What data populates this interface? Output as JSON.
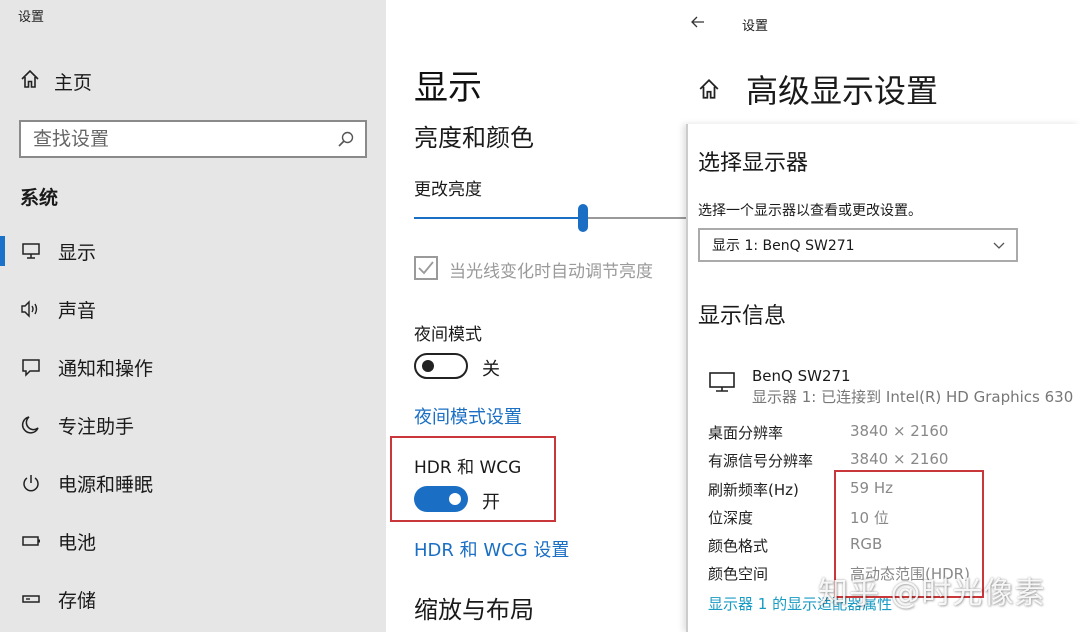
{
  "sidebar": {
    "window_title": "设置",
    "home_label": "主页",
    "search_placeholder": "查找设置",
    "section_label": "系统",
    "items": [
      {
        "label": "显示",
        "icon": "monitor-icon"
      },
      {
        "label": "声音",
        "icon": "speaker-icon"
      },
      {
        "label": "通知和操作",
        "icon": "notification-icon"
      },
      {
        "label": "专注助手",
        "icon": "moon-icon"
      },
      {
        "label": "电源和睡眠",
        "icon": "power-icon"
      },
      {
        "label": "电池",
        "icon": "battery-icon"
      },
      {
        "label": "存储",
        "icon": "storage-icon"
      }
    ]
  },
  "display": {
    "title": "显示",
    "brightness_heading": "亮度和颜色",
    "brightness_label": "更改亮度",
    "brightness_level": 0.62,
    "auto_brightness_label": "当光线变化时自动调节亮度",
    "night_mode_label": "夜间模式",
    "night_mode_state": "关",
    "night_mode_link": "夜间模式设置",
    "hdr_label": "HDR 和 WCG",
    "hdr_state": "开",
    "hdr_link": "HDR 和 WCG 设置",
    "scale_heading": "缩放与布局"
  },
  "advanced": {
    "breadcrumb": "设置",
    "title": "高级显示设置",
    "choose_heading": "选择显示器",
    "choose_sub": "选择一个显示器以查看或更改设置。",
    "selected_monitor": "显示 1: BenQ SW271",
    "info_heading": "显示信息",
    "monitor_name": "BenQ SW271",
    "monitor_desc": "显示器 1: 已连接到 Intel(R) HD Graphics 630",
    "rows": [
      {
        "key": "桌面分辨率",
        "value": "3840 × 2160"
      },
      {
        "key": "有源信号分辨率",
        "value": "3840 × 2160"
      },
      {
        "key": "刷新频率(Hz)",
        "value": "59 Hz"
      },
      {
        "key": "位深度",
        "value": "10 位"
      },
      {
        "key": "颜色格式",
        "value": "RGB"
      },
      {
        "key": "颜色空间",
        "value": "高动态范围(HDR)"
      }
    ],
    "adapter_link": "显示器 1 的显示适配器属性"
  },
  "watermark": "知乎 @时光像素",
  "colors": {
    "accent": "#1a6fc4",
    "highlight_box": "#c9373a",
    "sidebar_bg": "#e6e6e6"
  }
}
